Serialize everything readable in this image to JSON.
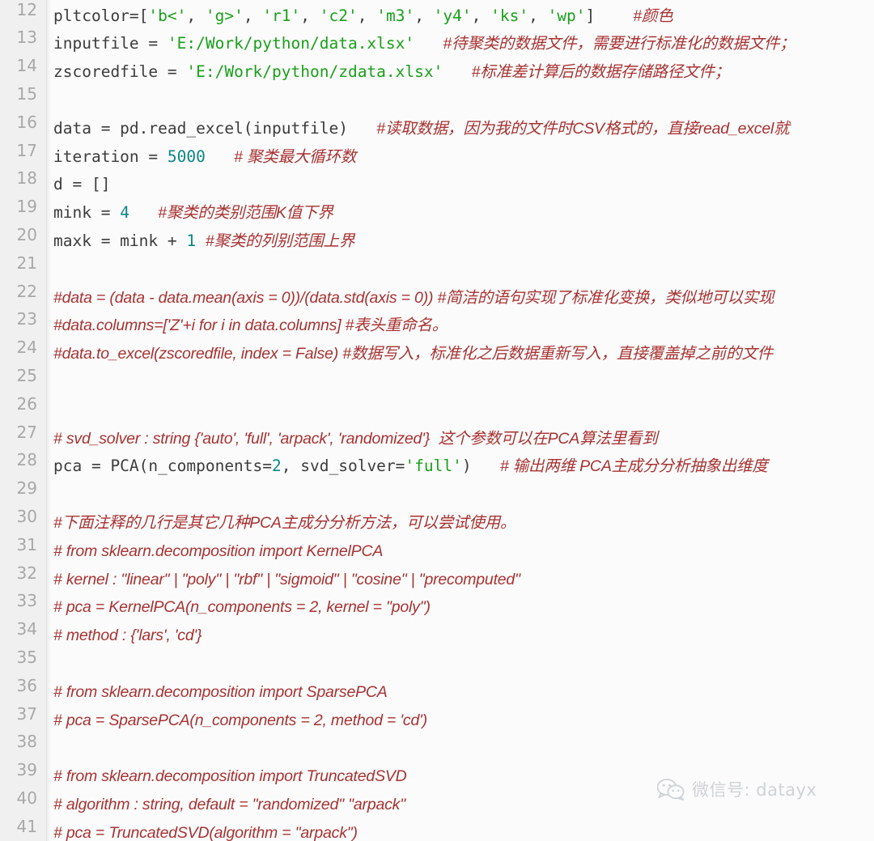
{
  "editor": {
    "language": "python",
    "first_line_number": 12,
    "gutter_color": "#f0f0f0",
    "background_color": "#fbfbfb",
    "colors": {
      "string": "#19a019",
      "number": "#0d8585",
      "comment": "#a83232",
      "plain": "#3c3c3c",
      "line_number": "#a8a8a8"
    },
    "lines": [
      {
        "number": "12",
        "tokens": [
          {
            "t": "pltcolor=[",
            "k": "p"
          },
          {
            "t": "'b<'",
            "k": "s"
          },
          {
            "t": ", ",
            "k": "p"
          },
          {
            "t": "'g>'",
            "k": "s"
          },
          {
            "t": ", ",
            "k": "p"
          },
          {
            "t": "'r1'",
            "k": "s"
          },
          {
            "t": ", ",
            "k": "p"
          },
          {
            "t": "'c2'",
            "k": "s"
          },
          {
            "t": ", ",
            "k": "p"
          },
          {
            "t": "'m3'",
            "k": "s"
          },
          {
            "t": ", ",
            "k": "p"
          },
          {
            "t": "'y4'",
            "k": "s"
          },
          {
            "t": ", ",
            "k": "p"
          },
          {
            "t": "'ks'",
            "k": "s"
          },
          {
            "t": ", ",
            "k": "p"
          },
          {
            "t": "'wp'",
            "k": "s"
          },
          {
            "t": "]    ",
            "k": "p"
          },
          {
            "t": "#颜色",
            "k": "c"
          }
        ]
      },
      {
        "number": "13",
        "tokens": [
          {
            "t": "inputfile = ",
            "k": "p"
          },
          {
            "t": "'E:/Work/python/data.xlsx'",
            "k": "s"
          },
          {
            "t": "   ",
            "k": "p"
          },
          {
            "t": "#待聚类的数据文件，需要进行标准化的数据文件；",
            "k": "c"
          }
        ]
      },
      {
        "number": "14",
        "tokens": [
          {
            "t": "zscoredfile = ",
            "k": "p"
          },
          {
            "t": "'E:/Work/python/zdata.xlsx'",
            "k": "s"
          },
          {
            "t": "   ",
            "k": "p"
          },
          {
            "t": "#标准差计算后的数据存储路径文件；",
            "k": "c"
          }
        ]
      },
      {
        "number": "15",
        "tokens": []
      },
      {
        "number": "16",
        "tokens": [
          {
            "t": "data = pd.read_excel(inputfile)",
            "k": "p"
          },
          {
            "t": "   ",
            "k": "p"
          },
          {
            "t": "#读取数据，因为我的文件时CSV格式的，直接read_excel就",
            "k": "c"
          }
        ]
      },
      {
        "number": "17",
        "tokens": [
          {
            "t": "iteration = ",
            "k": "p"
          },
          {
            "t": "5000",
            "k": "n"
          },
          {
            "t": "   ",
            "k": "p"
          },
          {
            "t": "# 聚类最大循环数",
            "k": "c"
          }
        ]
      },
      {
        "number": "18",
        "tokens": [
          {
            "t": "d = []",
            "k": "p"
          }
        ]
      },
      {
        "number": "19",
        "tokens": [
          {
            "t": "mink = ",
            "k": "p"
          },
          {
            "t": "4",
            "k": "n"
          },
          {
            "t": "   ",
            "k": "p"
          },
          {
            "t": "#聚类的类别范围K值下界",
            "k": "c"
          }
        ]
      },
      {
        "number": "20",
        "tokens": [
          {
            "t": "maxk = mink + ",
            "k": "p"
          },
          {
            "t": "1",
            "k": "n"
          },
          {
            "t": " ",
            "k": "p"
          },
          {
            "t": "#聚类的列别范围上界",
            "k": "c"
          }
        ]
      },
      {
        "number": "21",
        "tokens": []
      },
      {
        "number": "22",
        "comment_only": "#data = (data - data.mean(axis = 0))/(data.std(axis = 0)) #简洁的语句实现了标准化变换，类似地可以实现"
      },
      {
        "number": "23",
        "comment_only": "#data.columns=['Z'+i for i in data.columns] #表头重命名。"
      },
      {
        "number": "24",
        "comment_only": "#data.to_excel(zscoredfile, index = False) #数据写入，标准化之后数据重新写入，直接覆盖掉之前的文件"
      },
      {
        "number": "25",
        "tokens": []
      },
      {
        "number": "26",
        "tokens": []
      },
      {
        "number": "27",
        "comment_only": "# svd_solver : string {'auto', 'full', 'arpack', 'randomized'}  这个参数可以在PCA算法里看到"
      },
      {
        "number": "28",
        "tokens": [
          {
            "t": "pca = PCA(n_components=",
            "k": "p"
          },
          {
            "t": "2",
            "k": "n"
          },
          {
            "t": ", svd_solver=",
            "k": "p"
          },
          {
            "t": "'full'",
            "k": "s"
          },
          {
            "t": ")",
            "k": "p"
          },
          {
            "t": "   ",
            "k": "p"
          },
          {
            "t": "# 输出两维 PCA主成分分析抽象出维度",
            "k": "c"
          }
        ]
      },
      {
        "number": "29",
        "tokens": []
      },
      {
        "number": "30",
        "comment_only": "#下面注释的几行是其它几种PCA主成分分析方法，可以尝试使用。"
      },
      {
        "number": "31",
        "comment_only": "# from sklearn.decomposition import KernelPCA"
      },
      {
        "number": "32",
        "comment_only": "# kernel : \"linear\" | \"poly\" | \"rbf\" | \"sigmoid\" | \"cosine\" | \"precomputed\""
      },
      {
        "number": "33",
        "comment_only": "# pca = KernelPCA(n_components = 2, kernel = \"poly\")"
      },
      {
        "number": "34",
        "comment_only": "# method : {'lars', 'cd'}"
      },
      {
        "number": "35",
        "tokens": []
      },
      {
        "number": "36",
        "comment_only": "# from sklearn.decomposition import SparsePCA"
      },
      {
        "number": "37",
        "comment_only": "# pca = SparsePCA(n_components = 2, method = 'cd')"
      },
      {
        "number": "38",
        "tokens": []
      },
      {
        "number": "39",
        "comment_only": "# from sklearn.decomposition import TruncatedSVD"
      },
      {
        "number": "40",
        "comment_only": "# algorithm : string, default = \"randomized\" \"arpack\""
      },
      {
        "number": "41",
        "comment_only": "# pca = TruncatedSVD(algorithm = \"arpack\")"
      }
    ]
  },
  "watermark": {
    "icon": "wechat-icon",
    "text": "微信号: datayx",
    "color": "#cfd2d6"
  }
}
